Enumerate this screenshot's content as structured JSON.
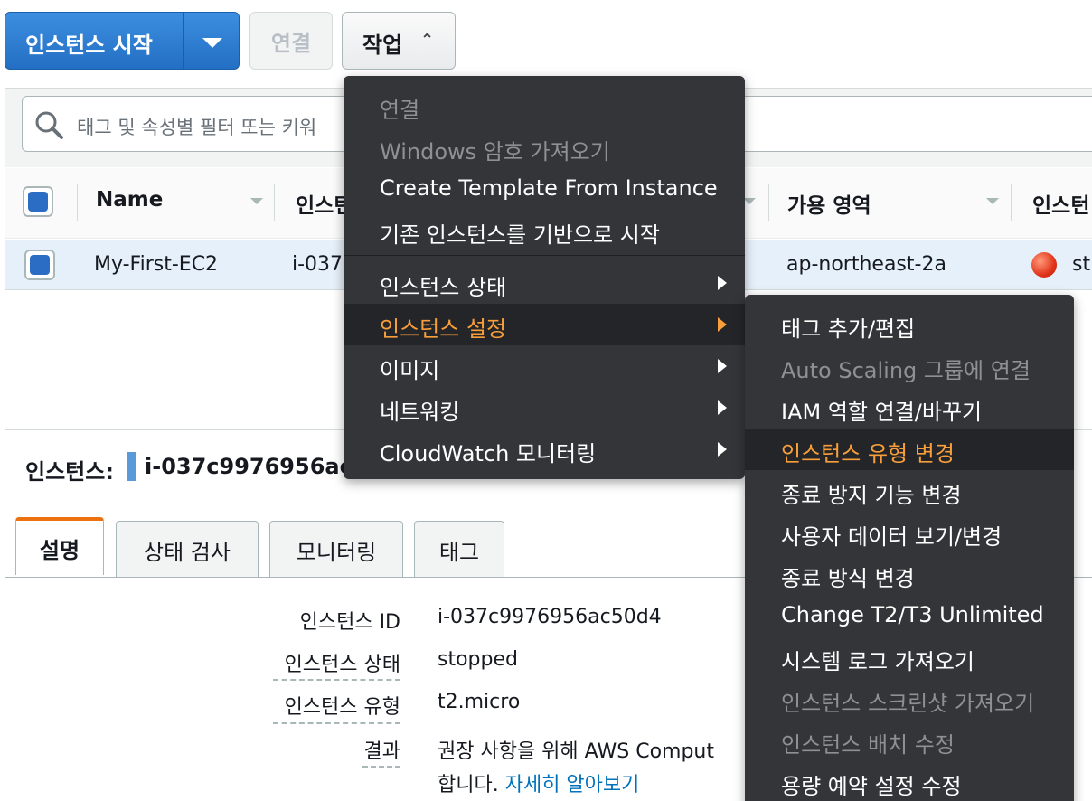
{
  "toolbar": {
    "launch_label": "인스턴스 시작",
    "connect_label": "연결",
    "actions_label": "작업",
    "actions_icon": "chevron-up-icon"
  },
  "search": {
    "placeholder": "태그 및 속성별 필터 또는 키워",
    "icon": "search-icon"
  },
  "table": {
    "headers": [
      "Name",
      "인스턴",
      "가용 영역",
      "인스턴"
    ],
    "rows": [
      {
        "name": "My-First-EC2",
        "instance_id": "i-037",
        "az": "ap-northeast-2a",
        "state": "st",
        "state_color": "#e2351a"
      }
    ]
  },
  "detail": {
    "title": "인스턴스:",
    "instance_id": "i-037c9976956ac",
    "tabs": [
      "설명",
      "상태 검사",
      "모니터링",
      "태그"
    ],
    "active_tab": "설명",
    "fields": [
      {
        "label": "인스턴스 ID",
        "value": "i-037c9976956ac50d4"
      },
      {
        "label": "인스턴스 상태",
        "value": "stopped"
      },
      {
        "label": "인스턴스 유형",
        "value": "t2.micro"
      },
      {
        "label": "결과",
        "value": "권장 사항을 위해 AWS Comput",
        "value2": "합니다.",
        "link": "자세히 알아보기"
      }
    ]
  },
  "actions_menu": {
    "items": [
      {
        "label": "연결",
        "disabled": true
      },
      {
        "label": "Windows 암호 가져오기",
        "disabled": true
      },
      {
        "label": "Create Template From Instance",
        "disabled": false
      },
      {
        "label": "기존 인스턴스를 기반으로 시작",
        "disabled": false
      },
      {
        "label": "인스턴스 상태",
        "submenu": true
      },
      {
        "label": "인스턴스 설정",
        "submenu": true,
        "highlighted": true
      },
      {
        "label": "이미지",
        "submenu": true
      },
      {
        "label": "네트워킹",
        "submenu": true
      },
      {
        "label": "CloudWatch 모니터링",
        "submenu": true
      }
    ]
  },
  "settings_submenu": {
    "items": [
      {
        "label": "태그 추가/편집",
        "disabled": false
      },
      {
        "label": "Auto Scaling 그룹에 연결",
        "disabled": true
      },
      {
        "label": "IAM 역할 연결/바꾸기",
        "disabled": false
      },
      {
        "label": "인스턴스 유형 변경",
        "highlighted": true
      },
      {
        "label": "종료 방지 기능 변경",
        "disabled": false
      },
      {
        "label": "사용자 데이터 보기/변경",
        "disabled": false
      },
      {
        "label": "종료 방식 변경",
        "disabled": false
      },
      {
        "label": "Change T2/T3 Unlimited",
        "disabled": false
      },
      {
        "label": "시스템 로그 가져오기",
        "disabled": false
      },
      {
        "label": "인스턴스 스크린샷 가져오기",
        "disabled": true
      },
      {
        "label": "인스턴스 배치 수정",
        "disabled": true
      },
      {
        "label": "용량 예약 설정 수정",
        "disabled": false
      }
    ]
  },
  "colors": {
    "primary": "#236fc4",
    "highlight": "#f89f3b",
    "menu_bg": "#333538",
    "tab_accent": "#ec7211",
    "link": "#0073bb"
  }
}
